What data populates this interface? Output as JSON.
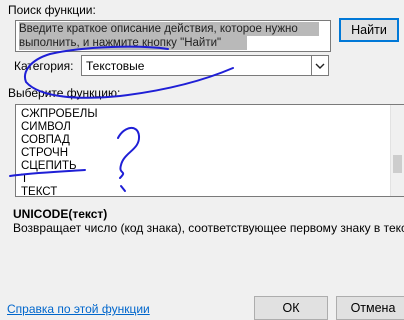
{
  "search": {
    "label": "Поиск функции:",
    "value_line1": "Введите краткое описание действия, которое нужно",
    "value_line2": "выполнить, и нажмите кнопку \"Найти\"",
    "find_button": "Найти"
  },
  "category": {
    "label": "Категория:",
    "selected": "Текстовые"
  },
  "functions": {
    "label": "Выберите функцию:",
    "items": [
      "СЖПРОБЕЛЫ",
      "СИМВОЛ",
      "СОВПАД",
      "СТРОЧН",
      "СЦЕПИТЬ",
      "Т",
      "ТЕКСТ"
    ]
  },
  "details": {
    "signature": "UNICODE(текст)",
    "description": "Возвращает число (код знака), соответствующее первому знаку в тексте."
  },
  "footer": {
    "help_link": "Справка по этой функции",
    "ok_button": "ОК",
    "cancel_button": "Отмена"
  },
  "colors": {
    "annotation_ink": "#1f1fd6",
    "link": "#0066cc",
    "focus_border": "#0078d7"
  }
}
